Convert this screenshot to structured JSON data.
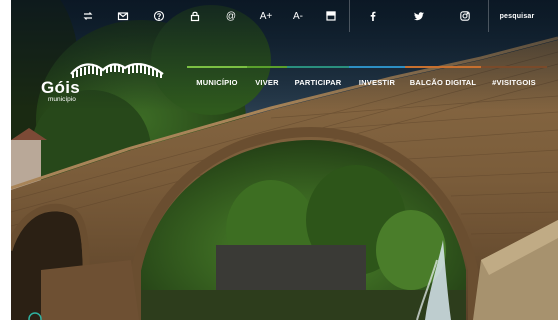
{
  "topbar": {
    "items": [
      {
        "icon": "refresh-icon"
      },
      {
        "icon": "mail-icon"
      },
      {
        "icon": "help-icon"
      },
      {
        "icon": "lock-icon"
      },
      {
        "label": "@"
      },
      {
        "label": "A+"
      },
      {
        "label": "A-"
      },
      {
        "icon": "contrast-icon"
      },
      {
        "icon": "facebook-icon"
      },
      {
        "icon": "twitter-icon"
      },
      {
        "icon": "instagram-icon"
      }
    ],
    "search_label": "pesquisar"
  },
  "logo": {
    "title": "Góis",
    "subtitle": "município"
  },
  "nav": {
    "items": [
      {
        "label": "MUNICÍPIO",
        "color": "#7bc043"
      },
      {
        "label": "VIVER",
        "color": "#5aa02c"
      },
      {
        "label": "PARTICIPAR",
        "color": "#2a8f7e"
      },
      {
        "label": "INVESTIR",
        "color": "#2d8fc4"
      },
      {
        "label": "BALCÃO DIGITAL",
        "color": "#c7702f"
      },
      {
        "label": "#VISITGOIS",
        "color": "#7a4a2a"
      }
    ]
  },
  "colors": {
    "bar_overlay": "#1b2b3a",
    "text": "#ffffff"
  }
}
